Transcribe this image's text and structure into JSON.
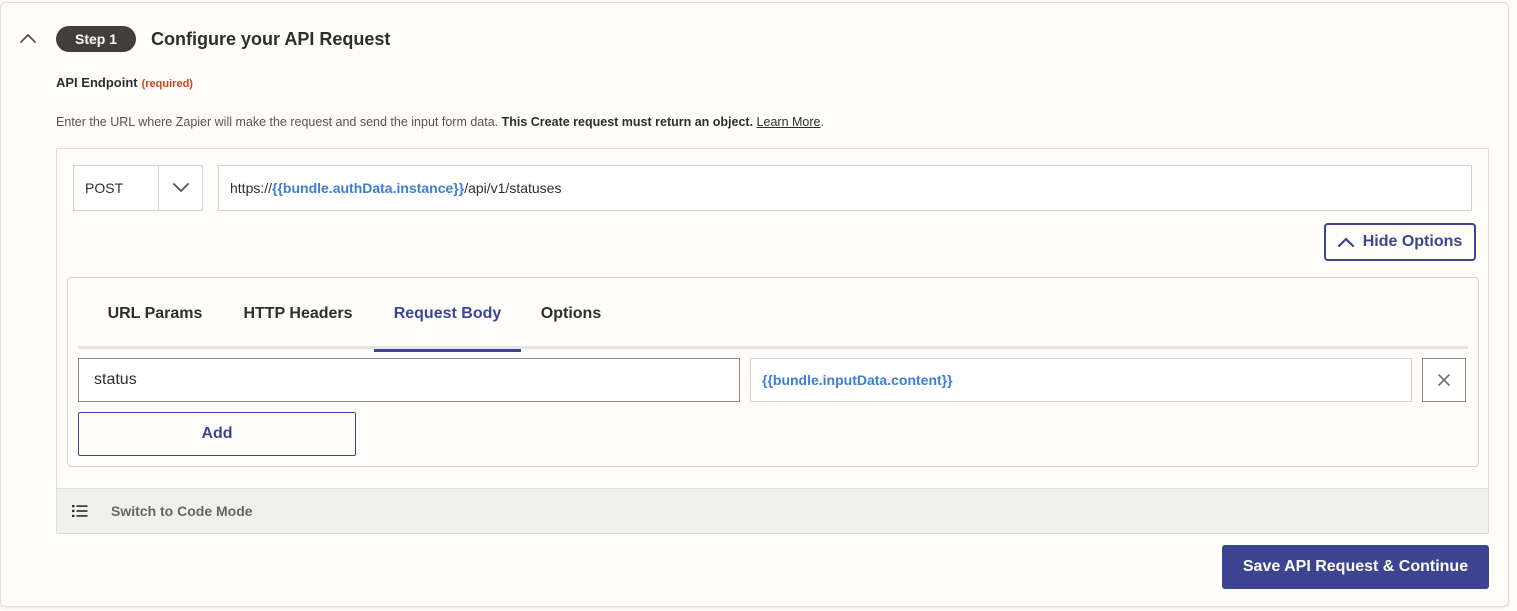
{
  "step": {
    "badge": "Step 1",
    "title": "Configure your API Request"
  },
  "endpoint": {
    "label": "API Endpoint",
    "required_label": "(required)",
    "help_text": "Enter the URL where Zapier will make the request and send the input form data. ",
    "help_bold": "This Create request must return an object.",
    "learn_more": "Learn More",
    "help_end": ".",
    "method": "POST",
    "url_prefix": "https://",
    "url_token": "{{bundle.authData.instance}}",
    "url_suffix": "/api/v1/statuses"
  },
  "options": {
    "hide_label": "Hide Options",
    "tabs": [
      {
        "label": "URL Params",
        "active": false
      },
      {
        "label": "HTTP Headers",
        "active": false
      },
      {
        "label": "Request Body",
        "active": true
      },
      {
        "label": "Options",
        "active": false
      }
    ],
    "body_rows": [
      {
        "key": "status",
        "value": "{{bundle.inputData.content}}"
      }
    ],
    "add_label": "Add"
  },
  "code_mode": {
    "label": "Switch to Code Mode"
  },
  "save_label": "Save API Request & Continue",
  "colors": {
    "accent": "#3d4592",
    "token": "#3b7dd8",
    "required": "#d4421c",
    "badge_bg": "#403f3e",
    "background": "#fffdf9"
  },
  "icons": {
    "collapse": "chevron-up-icon",
    "method_dropdown": "chevron-down-icon",
    "hide_options": "chevron-up-icon",
    "remove_row": "close-icon",
    "code_mode": "list-icon"
  }
}
